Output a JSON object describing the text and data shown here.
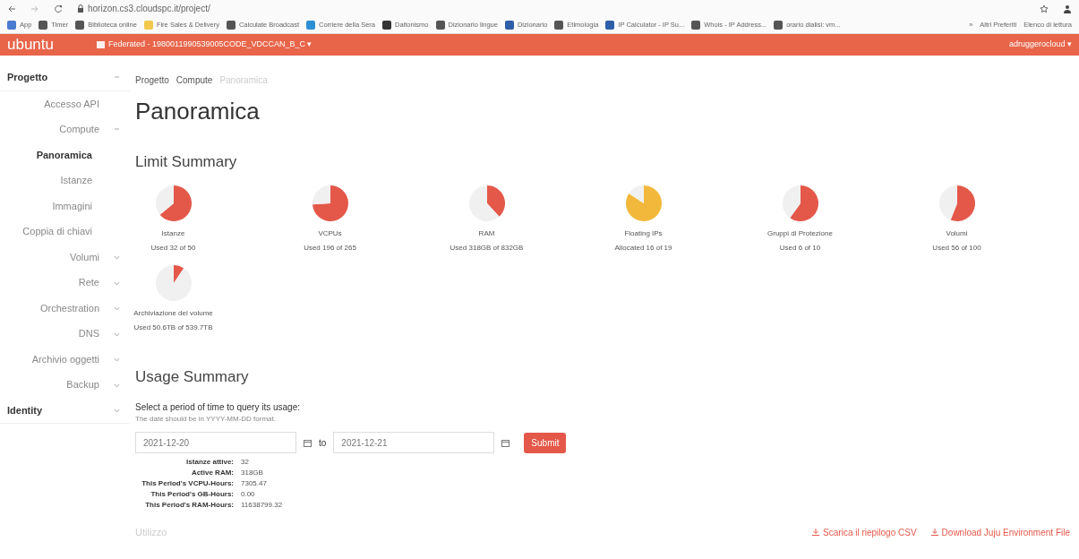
{
  "browser": {
    "url": "horizon.cs3.cloudspc.it/project/",
    "bookmarks": [
      {
        "label": "App",
        "color": "#4a7bd0"
      },
      {
        "label": "Timer",
        "color": "#555555"
      },
      {
        "label": "Biblioteca online",
        "color": "#555555"
      },
      {
        "label": "Fire Sales & Delivery",
        "color": "#f2c94c"
      },
      {
        "label": "Calculate Broadcast",
        "color": "#555555"
      },
      {
        "label": "Corriere della Sera",
        "color": "#2d8fd5"
      },
      {
        "label": "Daltonismo",
        "color": "#333333"
      },
      {
        "label": "Dizionario lingue",
        "color": "#555555"
      },
      {
        "label": "Dizionario",
        "color": "#2d5fa8"
      },
      {
        "label": "Etimologia",
        "color": "#555555"
      },
      {
        "label": "IP Calculator - IP Su...",
        "color": "#2d5fa8"
      },
      {
        "label": "Whois - IP Address...",
        "color": "#555555"
      },
      {
        "label": "orario dialisi: vm...",
        "color": "#555555"
      }
    ],
    "more": "»",
    "other_bookmarks": "Altri Preferiti",
    "reading_list": "Elenco di lettura"
  },
  "navbar": {
    "brand": "ubuntu",
    "project": "Federated - 1980011990539005CODE_VDCCAN_B_C",
    "project_caret": "▾",
    "user": "adruggerocloud",
    "user_caret": "▾"
  },
  "sidebar": {
    "items": [
      {
        "label": "Progetto",
        "expanded": true,
        "children": [
          {
            "label": "Accesso API",
            "selected": false
          },
          {
            "label": "Compute",
            "expanded": true,
            "children": [
              {
                "label": "Panoramica",
                "selected": true
              },
              {
                "label": "Istanze",
                "selected": false
              },
              {
                "label": "Immagini",
                "selected": false
              },
              {
                "label": "Coppia di chiavi",
                "selected": false
              }
            ]
          },
          {
            "label": "Volumi",
            "expanded": false
          },
          {
            "label": "Rete",
            "expanded": false
          },
          {
            "label": "Orchestration",
            "expanded": false
          },
          {
            "label": "DNS",
            "expanded": false
          },
          {
            "label": "Archivio oggetti",
            "expanded": false
          },
          {
            "label": "Backup",
            "expanded": false
          }
        ]
      },
      {
        "label": "Identity",
        "expanded": false
      }
    ]
  },
  "breadcrumb": [
    "Progetto",
    "Compute",
    "Panoramica"
  ],
  "page_title": "Panoramica",
  "limit_summary": {
    "title": "Limit Summary",
    "charts": [
      {
        "label": "Istanze",
        "reading": "Used 32 of 50",
        "color": "#e4584a",
        "chart_data": {
          "type": "pie",
          "values": [
            64,
            36
          ]
        }
      },
      {
        "label": "VCPUs",
        "reading": "Used 196 of 265",
        "color": "#e4584a",
        "chart_data": {
          "type": "pie",
          "values": [
            74,
            26
          ]
        }
      },
      {
        "label": "RAM",
        "reading": "Used 318GB of 832GB",
        "color": "#e4584a",
        "chart_data": {
          "type": "pie",
          "values": [
            38.2,
            61.8
          ]
        }
      },
      {
        "label": "Floating IPs",
        "reading": "Allocated 16 of 19",
        "color": "#f2b83b",
        "chart_data": {
          "type": "pie",
          "values": [
            84.2,
            15.8
          ]
        }
      },
      {
        "label": "Gruppi di Protezione",
        "reading": "Used 6 of 10",
        "color": "#e4584a",
        "chart_data": {
          "type": "pie",
          "values": [
            60,
            40
          ]
        }
      },
      {
        "label": "Volumi",
        "reading": "Used 56 of 100",
        "color": "#e4584a",
        "chart_data": {
          "type": "pie",
          "values": [
            56,
            44
          ]
        }
      },
      {
        "label": "Archiviazione del volume",
        "reading": "Used 50.6TB of 539.7TB",
        "color": "#e4584a",
        "chart_data": {
          "type": "pie",
          "values": [
            9.4,
            90.6
          ]
        }
      }
    ]
  },
  "usage_summary": {
    "title": "Usage Summary",
    "prompt": "Select a period of time to query its usage:",
    "help": "The date should be in YYYY-MM-DD format.",
    "from": "2021-12-20",
    "to_label": "to",
    "to": "2021-12-21",
    "submit": "Submit",
    "stats": [
      {
        "label": "Istanze attive:",
        "value": "32"
      },
      {
        "label": "Active RAM:",
        "value": "318GB"
      },
      {
        "label": "This Period's VCPU-Hours:",
        "value": "7305.47"
      },
      {
        "label": "This Period's GB-Hours:",
        "value": "0.00"
      },
      {
        "label": "This Period's RAM-Hours:",
        "value": "11638799.32"
      }
    ]
  },
  "footer": {
    "section": "Utilizzo",
    "links": [
      "Scarica il riepilogo CSV",
      "Download Juju Environment File"
    ]
  }
}
